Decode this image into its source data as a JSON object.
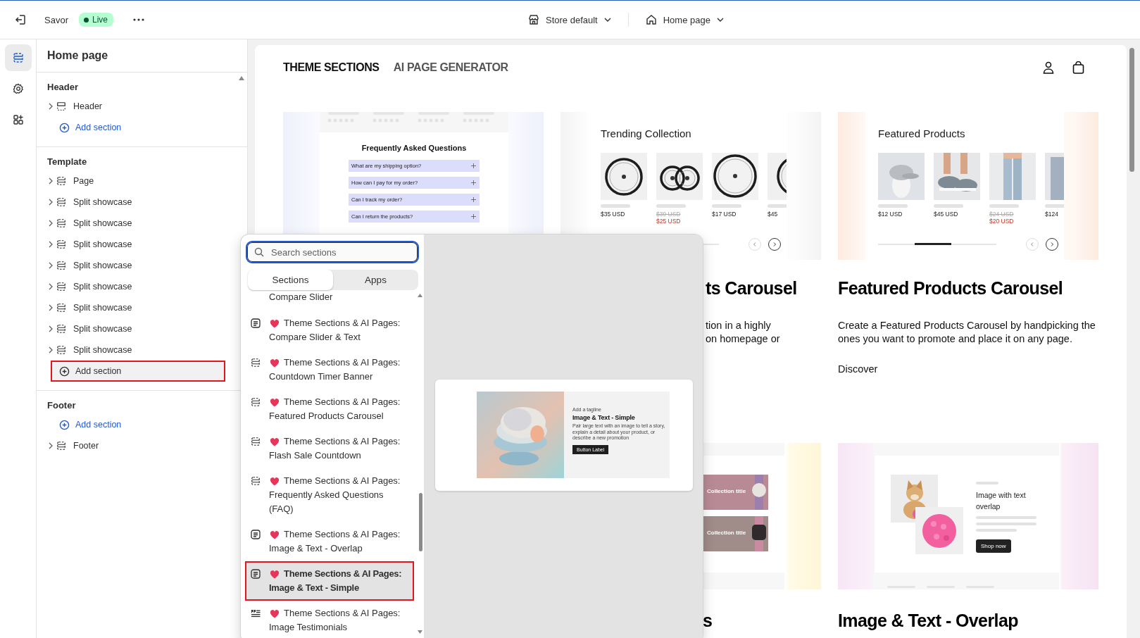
{
  "topbar": {
    "theme_name": "Savor",
    "status": "Live",
    "store": "Store default",
    "page": "Home page"
  },
  "rail": [
    {
      "selected": true
    },
    {
      "selected": false
    },
    {
      "selected": false
    }
  ],
  "sidebar": {
    "title": "Home page",
    "groups": [
      {
        "heading": "Header",
        "entries": [
          {
            "kind": "header",
            "label": "Header"
          },
          {
            "kind": "add",
            "label": "Add section",
            "highlighted": false
          }
        ]
      },
      {
        "heading": "Template",
        "entries": [
          {
            "kind": "item",
            "label": "Page"
          },
          {
            "kind": "item",
            "label": "Split showcase"
          },
          {
            "kind": "item",
            "label": "Split showcase"
          },
          {
            "kind": "item",
            "label": "Split showcase"
          },
          {
            "kind": "item",
            "label": "Split showcase"
          },
          {
            "kind": "item",
            "label": "Split showcase"
          },
          {
            "kind": "item",
            "label": "Split showcase"
          },
          {
            "kind": "item",
            "label": "Split showcase"
          },
          {
            "kind": "item",
            "label": "Split showcase"
          },
          {
            "kind": "add",
            "label": "Add section",
            "highlighted": true
          }
        ]
      },
      {
        "heading": "Footer",
        "entries": [
          {
            "kind": "add",
            "label": "Add section",
            "highlighted": false
          },
          {
            "kind": "item",
            "label": "Footer"
          }
        ]
      }
    ]
  },
  "storefront": {
    "nav": [
      "THEME SECTIONS",
      "AI PAGE GENERATOR"
    ],
    "row1": {
      "cards": [
        {
          "kind": "faq",
          "heading": "Frequently Asked Questions",
          "questions": [
            "What are my shipping option?",
            "How can I pay for my order?",
            "Can I track my order?",
            "Can I return the products?"
          ]
        },
        {
          "kind": "products",
          "heading": "Trending Collection",
          "products": [
            {
              "price": "$35 USD"
            },
            {
              "price": "$25 USD",
              "was": "$39 USD"
            },
            {
              "price": "$17 USD"
            },
            {
              "price": "$45"
            }
          ]
        },
        {
          "kind": "products",
          "heading": "Featured Products",
          "products": [
            {
              "price": "$12 USD"
            },
            {
              "price": "$45 USD"
            },
            {
              "price": "$20 USD",
              "was": "$24 USD"
            },
            {
              "price": "$124"
            }
          ]
        }
      ],
      "texts": [
        {
          "title": "ts Carousel",
          "desc": "tion in a highly\non homepage or"
        },
        {
          "title": "Featured Products Carousel",
          "desc": "Create a Featured Products Carousel by handpicking the ones you want to promote and place it on any page.",
          "link": "Discover"
        }
      ]
    },
    "row2": {
      "cards": [
        {
          "kind": "collections",
          "tiles": [
            "Collection title",
            "Collection title"
          ]
        },
        {
          "kind": "image_text",
          "heading": "Image with text overlap",
          "button": "Shop now"
        }
      ],
      "titles": [
        "s",
        "Image & Text - Overlap"
      ]
    }
  },
  "popup": {
    "search": {
      "placeholder": "Search sections"
    },
    "tabs": [
      {
        "label": "Sections",
        "selected": true
      },
      {
        "label": "Apps",
        "selected": false
      }
    ],
    "items": [
      {
        "kind": "cut",
        "label": "Compare Slider"
      },
      {
        "kind": "document",
        "label": "Theme Sections & AI Pages: Compare Slider & Text",
        "selected": false,
        "highlighted": false
      },
      {
        "kind": "section",
        "label": "Theme Sections & AI Pages: Countdown Timer Banner",
        "selected": false,
        "highlighted": false
      },
      {
        "kind": "section",
        "label": "Theme Sections & AI Pages: Featured Products Carousel",
        "selected": false,
        "highlighted": false
      },
      {
        "kind": "section",
        "label": "Theme Sections & AI Pages: Flash Sale Countdown",
        "selected": false,
        "highlighted": false
      },
      {
        "kind": "section",
        "label": "Theme Sections & AI Pages: Frequently Asked Questions (FAQ)",
        "selected": false,
        "highlighted": false
      },
      {
        "kind": "document",
        "label": "Theme Sections & AI Pages: Image & Text - Overlap",
        "selected": false,
        "highlighted": false
      },
      {
        "kind": "document",
        "label": "Theme Sections & AI Pages: Image & Text - Simple",
        "selected": true,
        "highlighted": true
      },
      {
        "kind": "quote",
        "label": "Theme Sections & AI Pages: Image Testimonials",
        "selected": false,
        "highlighted": false
      }
    ],
    "preview": {
      "tagline": "Add a tagline",
      "title": "Image & Text - Simple",
      "body": "Pair large text with an image to tell a story, explain a detail about your product, or describe a new promotion",
      "button": "Button Label"
    }
  }
}
